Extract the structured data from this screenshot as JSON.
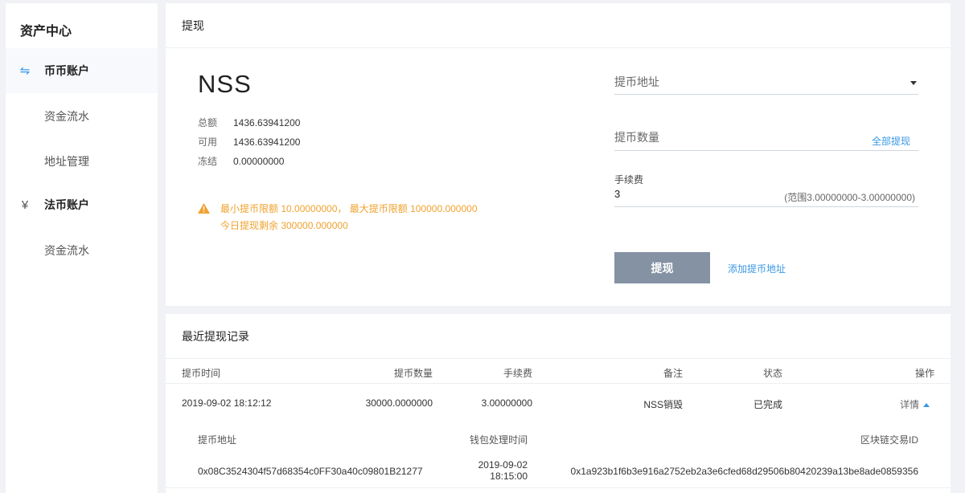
{
  "sidebar": {
    "title": "资产中心",
    "groups": [
      {
        "label": "币币账户",
        "icon": "exchange-icon",
        "subs": [
          "资金流水",
          "地址管理"
        ]
      },
      {
        "label": "法币账户",
        "icon": "yen-icon",
        "subs": [
          "资金流水"
        ]
      }
    ]
  },
  "withdraw": {
    "header": "提现",
    "coin": "NSS",
    "balances": [
      {
        "label": "总额",
        "value": "1436.63941200"
      },
      {
        "label": "可用",
        "value": "1436.63941200"
      },
      {
        "label": "冻结",
        "value": "0.00000000"
      }
    ],
    "warning_line1": "最小提币限额 10.00000000， 最大提币限额 100000.000000",
    "warning_line2": "今日提现剩余 300000.000000",
    "address_placeholder": "提币地址",
    "amount_placeholder": "提币数量",
    "withdraw_all": "全部提现",
    "fee_label": "手续费",
    "fee_value": "3",
    "fee_range": "(范围3.00000000-3.00000000)",
    "submit": "提现",
    "add_address": "添加提币地址"
  },
  "records": {
    "header": "最近提现记录",
    "columns": [
      "提币时间",
      "提币数量",
      "手续费",
      "备注",
      "状态",
      "操作"
    ],
    "rows": [
      {
        "time": "2019-09-02 18:12:12",
        "amount": "30000.0000000",
        "fee": "3.00000000",
        "note": "NSS销毁",
        "status": "已完成",
        "action": "详情",
        "detail": {
          "columns": [
            "提币地址",
            "钱包处理时间",
            "区块链交易ID"
          ],
          "address": "0x08C3524304f57d68354c0FF30a40c09801B21277",
          "wallet_date": "2019-09-02",
          "wallet_time": "18:15:00",
          "txid": "0x1a923b1f6b3e916a2752eb2a3e6cfed68d29506b80420239a13be8ade0859356"
        }
      }
    ]
  },
  "colors": {
    "accent": "#3a98e4",
    "warning": "#f0a22e",
    "button": "#8492a3"
  }
}
